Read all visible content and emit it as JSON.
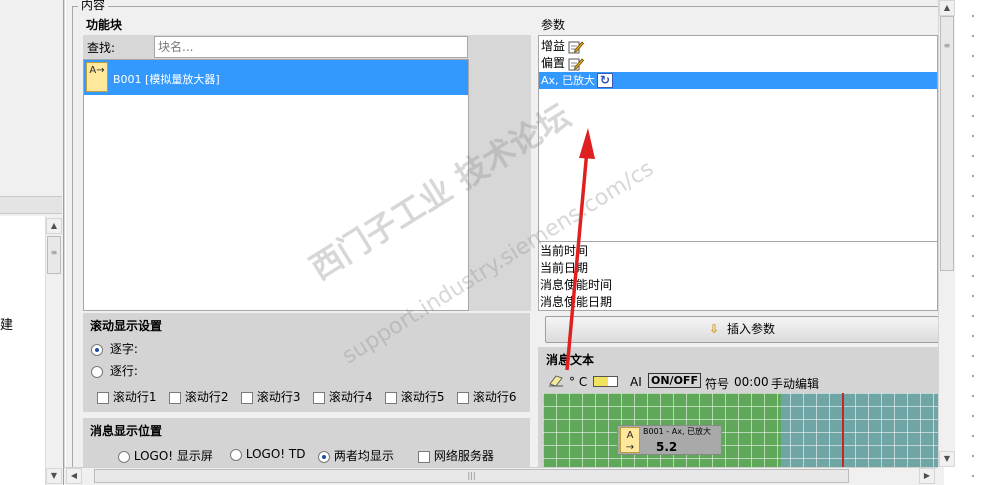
{
  "group": {
    "title": "内容"
  },
  "blocks": {
    "title": "功能块",
    "search_label": "查找:",
    "search_placeholder": "块名...",
    "items": [
      {
        "icon_text": "A→",
        "label": "B001 [模拟量放大器]"
      }
    ]
  },
  "params": {
    "title": "参数",
    "items": [
      {
        "label": "增益",
        "icon": "edit-icon"
      },
      {
        "label": "偏置",
        "icon": "edit-icon"
      },
      {
        "label": "Ax, 已放大",
        "icon": "refresh-icon",
        "selected": true
      }
    ],
    "system_items": [
      "当前时间",
      "当前日期",
      "消息使能时间",
      "消息使能日期"
    ],
    "insert_label": "插入参数"
  },
  "scroll_settings": {
    "title": "滚动显示设置",
    "by_char": "逐字:",
    "by_line": "逐行:",
    "lines": [
      "滚动行1",
      "滚动行2",
      "滚动行3",
      "滚动行4",
      "滚动行5",
      "滚动行6"
    ]
  },
  "msg_position": {
    "title": "消息显示位置",
    "options": [
      "LOGO! 显示屏",
      "LOGO! TD",
      "两者均显示"
    ],
    "web_server": "网络服务器"
  },
  "msg_text": {
    "title": "消息文本",
    "toolbar": {
      "degree": "° C",
      "ai": "AI",
      "onoff": "ON/OFF",
      "symbol": "符号",
      "time": "00:00",
      "manual": "手动编辑"
    },
    "block_title": "B001 - Ax, 已放大",
    "block_value": "5.2"
  },
  "left": {
    "char": "建"
  },
  "watermark": {
    "main": "西门子工业 技术论坛",
    "sub": "support.industry.siemens.com/cs"
  },
  "colors": {
    "selection": "#3399ff",
    "canvas_green": "#5fa859",
    "canvas_teal": "#6fa5a5",
    "annotation_red": "#e02020"
  }
}
